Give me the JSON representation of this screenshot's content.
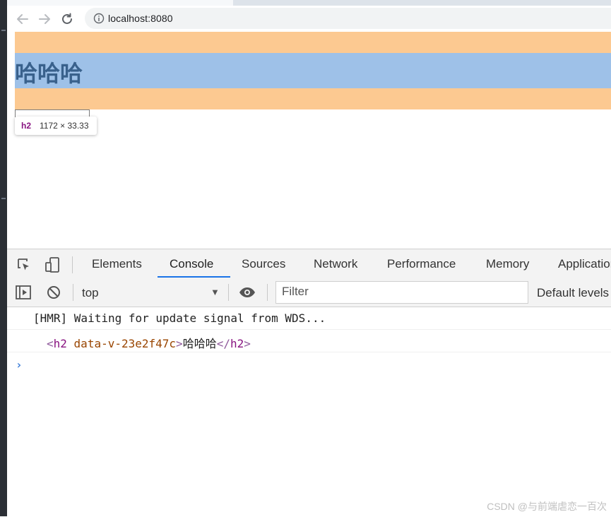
{
  "browser": {
    "url": "localhost:8080",
    "back_icon": "back-arrow-icon",
    "forward_icon": "forward-arrow-icon",
    "reload_icon": "reload-icon",
    "info_icon": "info-icon"
  },
  "page": {
    "heading": "哈哈哈",
    "highlight_colors": {
      "margin": "#fcc991",
      "content": "#9ec1e8"
    },
    "inspect_tooltip": {
      "tag": "h2",
      "dimensions": "1172 × 33.33"
    }
  },
  "devtools": {
    "tabs": [
      "Elements",
      "Console",
      "Sources",
      "Network",
      "Performance",
      "Memory",
      "Application"
    ],
    "active_tab": "Console",
    "toolbar": {
      "context": "top",
      "filter_placeholder": "Filter",
      "levels_label": "Default levels"
    },
    "console": {
      "line1": "[HMR] Waiting for update signal from WDS...",
      "line2": {
        "open_lt": "<",
        "tag": "h2",
        "attr": "data-v-23e2f47c",
        "open_gt": ">",
        "text": "哈哈哈",
        "close_lt": "</",
        "close_tag": "h2",
        "close_gt": ">"
      },
      "prompt": "›"
    }
  },
  "watermark": "CSDN @与前端虐恋一百次"
}
